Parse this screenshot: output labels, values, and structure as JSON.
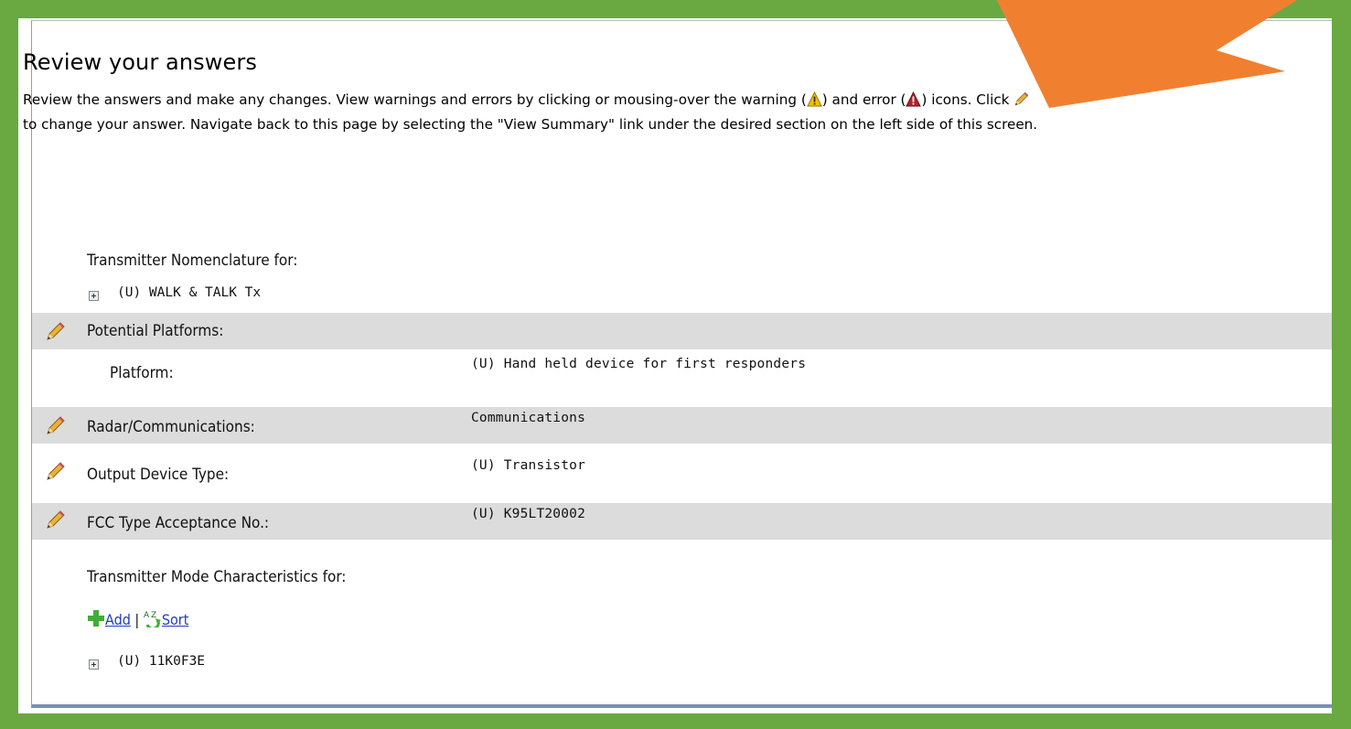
{
  "review": {
    "title": "Review your answers",
    "intro_1": "Review the answers and make any changes. View warnings and errors by clicking or mousing-over the warning (",
    "intro_2": ") and error (",
    "intro_3": ") icons. Click",
    "intro_4": "to change your answer. Navigate back to this page by selecting the \"View Summary\" link under the desired section on the left side of this screen."
  },
  "summary": {
    "transmitter_nomenclature_label": "Transmitter Nomenclature for:",
    "transmitter_node": "(U) WALK & TALK Tx",
    "potential_platforms_label": "Potential Platforms:",
    "platform_label": "Platform:",
    "platform_value": "(U) Hand held device for first responders",
    "radar_comm_label": "Radar/Communications:",
    "radar_comm_value": "Communications",
    "output_device_label": "Output Device Type:",
    "output_device_value": "(U) Transistor",
    "fcc_label": "FCC Type Acceptance No.:",
    "fcc_value": "(U) K95LT20002",
    "mode_characteristics_label": "Transmitter Mode Characteristics for:",
    "add_label": "Add",
    "separator": "|",
    "sort_label": "Sort",
    "mode_node": "(U) 11K0F3E"
  },
  "colors": {
    "frame_green": "#6aa842",
    "arrow_orange": "#f08030",
    "shaded_row": "#dcdcdc",
    "link_blue": "#1f3cc6"
  },
  "icons": [
    "warning-icon",
    "error-icon",
    "pencil-icon",
    "expand-icon",
    "add-icon",
    "sort-az-icon",
    "arrow-annotation"
  ]
}
